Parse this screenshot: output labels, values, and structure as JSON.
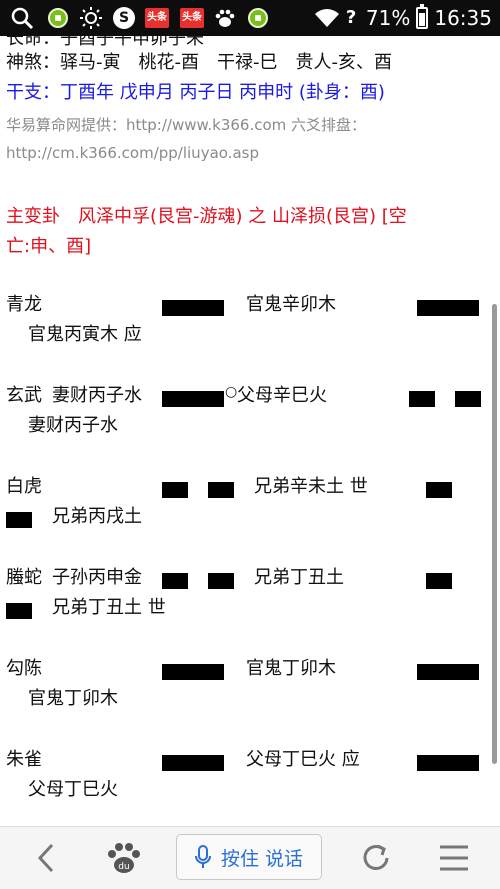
{
  "status_bar": {
    "battery_percent": "71%",
    "time": "16:35",
    "toutiao_label": "头条",
    "search_app_letter": "S"
  },
  "text": {
    "cut_top": "长命：子酉子午申卯子未",
    "line_shensha": "神煞：驿马-寅　桃花-酉　干禄-巳　贵人-亥、酉",
    "line_ganzhi": "干支：丁酉年  戊申月  丙子日  丙申时 (卦身：酉)",
    "provider_line1": "华易算命网提供：http://www.k366.com  六爻排盘：",
    "provider_line2": "http://cm.k366.com/pp/liuyao.asp",
    "main_title_1": "主变卦　风泽中孚(艮宫-游魂) 之 山泽损(艮宫) [空",
    "main_title_2": "亡:申、酉]"
  },
  "rows": [
    {
      "god": "青龙",
      "main_text": "",
      "changed": "官鬼辛卯木",
      "wrap": "官鬼丙寅木 应",
      "main": "yang",
      "moving": false,
      "right": "yang",
      "wrap_line": ""
    },
    {
      "god": "玄武",
      "main_text": "妻财丙子水",
      "changed": "父母辛巳火",
      "wrap": "妻财丙子水",
      "main": "yang",
      "moving": true,
      "moving_mark": "○",
      "right": "yin",
      "wrap_line": ""
    },
    {
      "god": "白虎",
      "main_text": "",
      "changed": "兄弟辛未土 世",
      "wrap": "兄弟丙戌土",
      "main": "yin",
      "moving": false,
      "right": "yang_short",
      "wrap_line": "yang_short"
    },
    {
      "god": "螣蛇",
      "main_text": "子孙丙申金",
      "changed": "兄弟丁丑土",
      "wrap": "兄弟丁丑土 世",
      "main": "yin",
      "moving": false,
      "right": "yang_short",
      "wrap_line": "yang_short"
    },
    {
      "god": "勾陈",
      "main_text": "",
      "changed": "官鬼丁卯木",
      "wrap": "官鬼丁卯木",
      "main": "yang",
      "moving": false,
      "right": "yang",
      "wrap_line": ""
    },
    {
      "god": "朱雀",
      "main_text": "",
      "changed": "父母丁巳火 应",
      "wrap": "父母丁巳火",
      "main": "yang",
      "moving": false,
      "right": "yang",
      "wrap_line": ""
    }
  ],
  "bottom_bar": {
    "voice_label": "按住 说话"
  },
  "colors": {
    "blue": "#1a1ae6",
    "red": "#e0101e",
    "gray": "#8a8a8a"
  }
}
